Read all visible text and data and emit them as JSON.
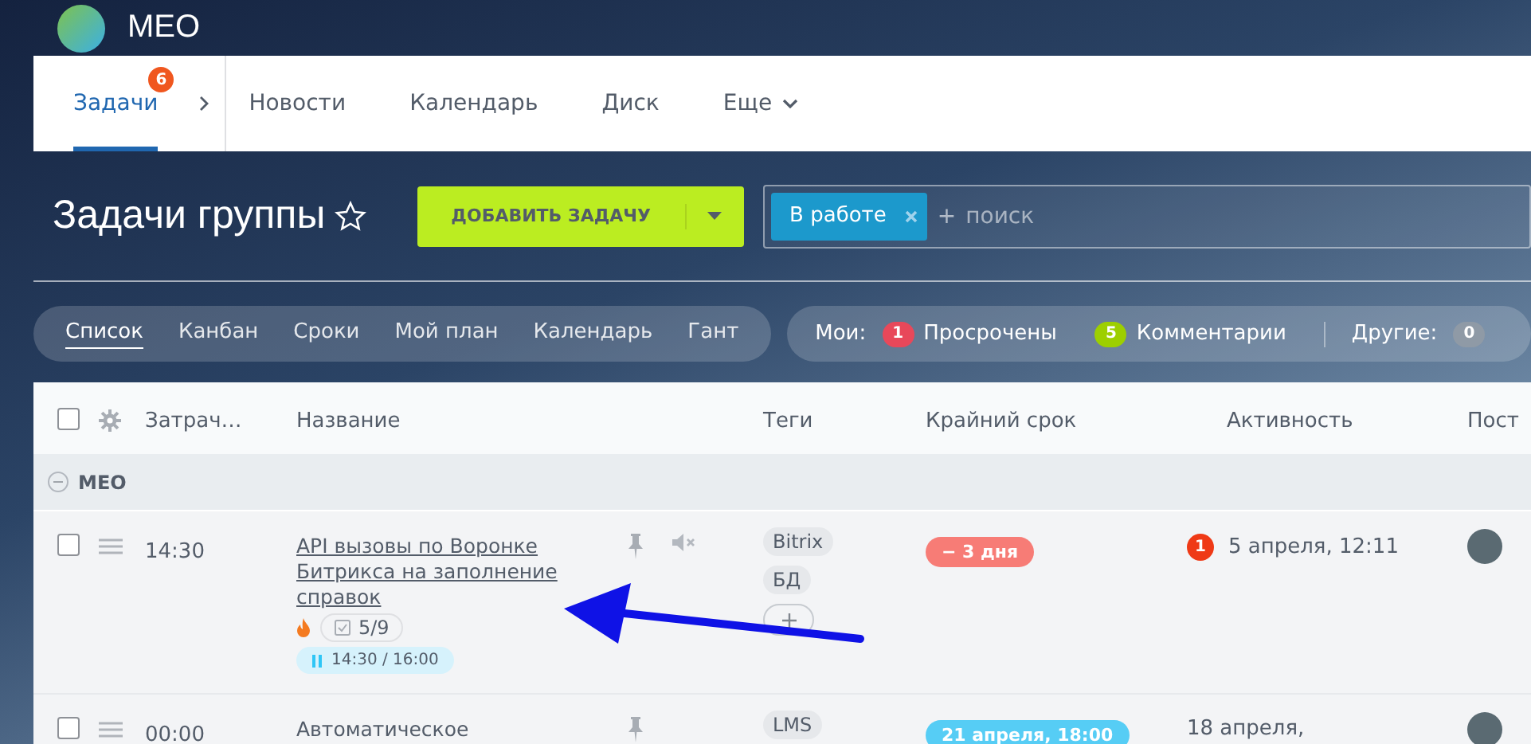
{
  "header": {
    "title": "МЕО"
  },
  "nav": {
    "items": [
      {
        "label": "Задачи",
        "selected": true,
        "badge": "6",
        "submenu": true
      },
      {
        "label": "Новости",
        "selected": false
      },
      {
        "label": "Календарь",
        "selected": false
      },
      {
        "label": "Диск",
        "selected": false
      },
      {
        "label": "Еще",
        "selected": false,
        "dropdown": true
      }
    ]
  },
  "page_title": "Задачи группы",
  "favorite": false,
  "add_button": "ДОБАВИТЬ ЗАДАЧУ",
  "filter": {
    "chips": [
      {
        "label": "В работе"
      }
    ],
    "add_hint": "+",
    "placeholder": "поиск"
  },
  "views": [
    {
      "label": "Список",
      "selected": true
    },
    {
      "label": "Канбан",
      "selected": false
    },
    {
      "label": "Сроки",
      "selected": false
    },
    {
      "label": "Мой план",
      "selected": false
    },
    {
      "label": "Календарь",
      "selected": false
    },
    {
      "label": "Гант",
      "selected": false
    }
  ],
  "counters": {
    "label": "Мои:",
    "items": [
      {
        "count": "1",
        "label": "Просрочены",
        "color": "#e8485a"
      },
      {
        "count": "5",
        "label": "Комментарии",
        "color": "#9dcf00"
      }
    ],
    "others_label": "Другие:",
    "others_count": "0"
  },
  "table": {
    "all_checked": false,
    "columns": [
      "Затрач…",
      "Название",
      "Теги",
      "Крайний срок",
      "Активность",
      "Пост"
    ],
    "groups": [
      {
        "title": "МЕО",
        "expanded": true,
        "rows": [
          {
            "checked": false,
            "time": "14:30",
            "title": "API вызовы по Воронке Битрикса на заполнение справок",
            "underlined": true,
            "hot": true,
            "checklist": "5/9",
            "timer": "14:30 / 16:00",
            "muted": true,
            "tags": [
              "Bitrix",
              "БД"
            ],
            "add_tag": true,
            "deadline": "− 3 дня",
            "overdue": true,
            "activity_count": "1",
            "activity": "5 апреля, 12:11"
          },
          {
            "checked": false,
            "time": "00:00",
            "title": "Автоматическое",
            "underlined": false,
            "tags": [
              "LMS"
            ],
            "deadline": "21 апреля, 18:00",
            "overdue": false,
            "activity": "18 апреля,"
          }
        ]
      }
    ]
  },
  "annotation": {
    "kind": "arrow"
  }
}
